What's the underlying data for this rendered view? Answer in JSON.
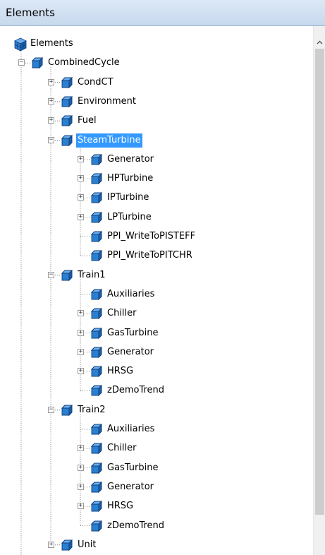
{
  "panel": {
    "title": "Elements"
  },
  "tree": {
    "root": "Elements",
    "nodes": [
      {
        "label": "CombinedCycle",
        "level": 1,
        "expander": "minus"
      },
      {
        "label": "CondCT",
        "level": 2,
        "expander": "plus"
      },
      {
        "label": "Environment",
        "level": 2,
        "expander": "plus"
      },
      {
        "label": "Fuel",
        "level": 2,
        "expander": "plus"
      },
      {
        "label": "SteamTurbine",
        "level": 2,
        "expander": "minus",
        "selected": true
      },
      {
        "label": "Generator",
        "level": 3,
        "expander": "plus"
      },
      {
        "label": "HPTurbine",
        "level": 3,
        "expander": "plus"
      },
      {
        "label": "IPTurbine",
        "level": 3,
        "expander": "plus"
      },
      {
        "label": "LPTurbine",
        "level": 3,
        "expander": "plus"
      },
      {
        "label": "PPI_WriteToPISTEFF",
        "level": 3,
        "expander": "none"
      },
      {
        "label": "PPI_WriteToPITCHR",
        "level": 3,
        "expander": "none"
      },
      {
        "label": "Train1",
        "level": 2,
        "expander": "minus"
      },
      {
        "label": "Auxiliaries",
        "level": 3,
        "expander": "none"
      },
      {
        "label": "Chiller",
        "level": 3,
        "expander": "plus"
      },
      {
        "label": "GasTurbine",
        "level": 3,
        "expander": "plus"
      },
      {
        "label": "Generator",
        "level": 3,
        "expander": "plus"
      },
      {
        "label": "HRSG",
        "level": 3,
        "expander": "plus"
      },
      {
        "label": "zDemoTrend",
        "level": 3,
        "expander": "none"
      },
      {
        "label": "Train2",
        "level": 2,
        "expander": "minus"
      },
      {
        "label": "Auxiliaries",
        "level": 3,
        "expander": "none"
      },
      {
        "label": "Chiller",
        "level": 3,
        "expander": "plus"
      },
      {
        "label": "GasTurbine",
        "level": 3,
        "expander": "plus"
      },
      {
        "label": "Generator",
        "level": 3,
        "expander": "plus"
      },
      {
        "label": "HRSG",
        "level": 3,
        "expander": "plus"
      },
      {
        "label": "zDemoTrend",
        "level": 3,
        "expander": "none"
      },
      {
        "label": "Unit",
        "level": 2,
        "expander": "plus"
      }
    ]
  },
  "colors": {
    "selection": "#3399ff",
    "cube_fill": "#2a7fd0",
    "cube_stroke": "#123f78",
    "tree_lines": "#7a7a7a"
  },
  "icons": {
    "element": "cube-icon",
    "root": "elements-root-icon",
    "scroll_up": "chevron-up-icon"
  }
}
